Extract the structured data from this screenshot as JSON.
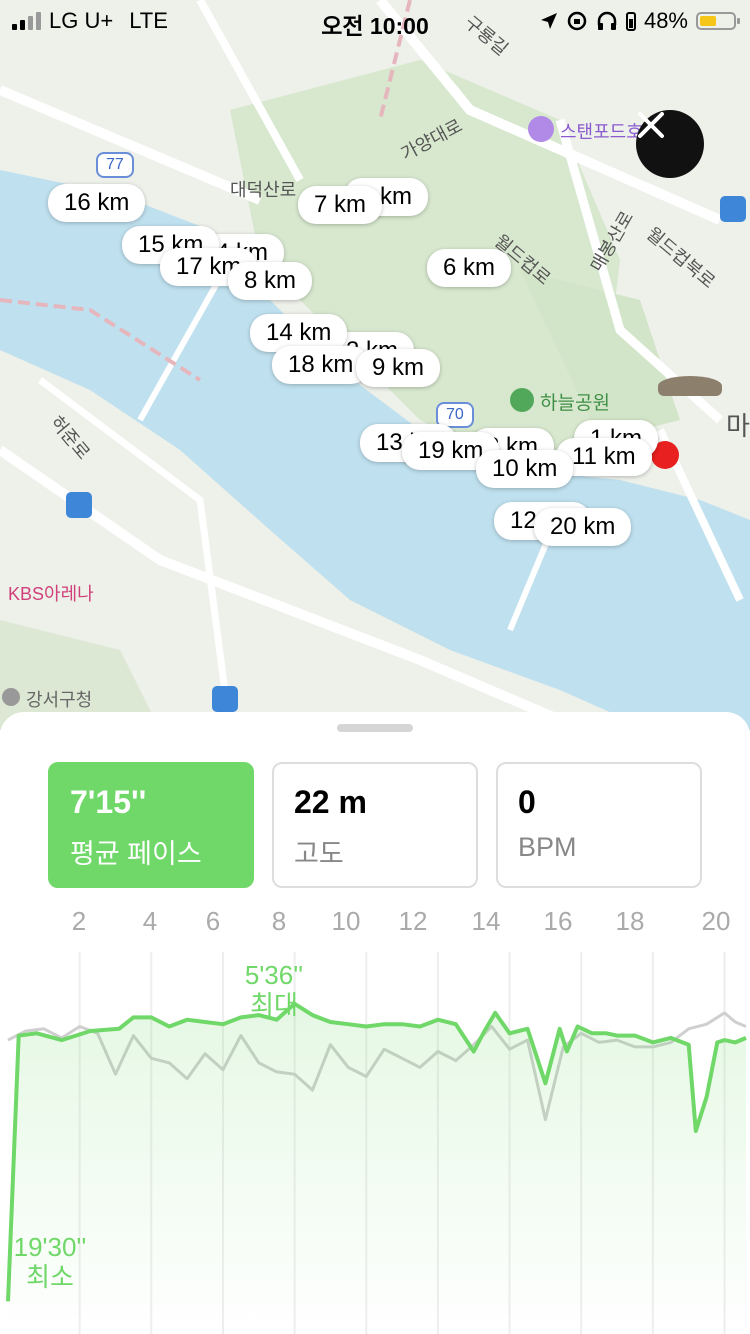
{
  "status_bar": {
    "carrier": "LG U+",
    "network": "LTE",
    "time": "오전 10:00",
    "battery": "48%"
  },
  "map": {
    "labels": {
      "road_77": "77",
      "road_70": "70",
      "guryong": "구룡길",
      "gayang": "가양대로",
      "hotel": "스탠포드호",
      "daedeok": "대덕산로",
      "maebong": "매봉산로",
      "worldcup": "월드컵북로",
      "worldcup2": "월드컵로",
      "haneul": "하늘공원",
      "heojun": "허준로",
      "kbs": "KBS아레나",
      "gangseo": "강서구청",
      "ma": "마"
    },
    "km_markers": [
      "16 km",
      "7 km",
      "5 km",
      "15 km",
      "4 km",
      "17 km",
      "8 km",
      "6 km",
      "14 km",
      "3 km",
      "18 km",
      "9 km",
      "13 km",
      "19 km",
      "2 km",
      "10 km",
      "1 km",
      "11 km",
      "12 km",
      "20 km"
    ]
  },
  "cards": [
    {
      "value": "7'15''",
      "label": "평균 페이스",
      "active": true
    },
    {
      "value": "22 m",
      "label": "고도",
      "active": false
    },
    {
      "value": "0",
      "label": "BPM",
      "active": false
    }
  ],
  "chart_data": {
    "type": "line",
    "x_ticks": [
      "2",
      "4",
      "6",
      "8",
      "10",
      "12",
      "14",
      "16",
      "18",
      "20"
    ],
    "annotations": {
      "max_value": "5'36''",
      "max_label": "최대",
      "min_value": "19'30''",
      "min_label": "최소"
    },
    "series": [
      {
        "color": "#6fd868",
        "x": [
          0,
          0.3,
          0.8,
          1.5,
          2.3,
          3.1,
          3.5,
          4.0,
          4.5,
          5.0,
          5.5,
          6.0,
          6.5,
          7.0,
          7.5,
          8.0,
          8.5,
          9.0,
          9.5,
          10.0,
          10.5,
          11.0,
          11.5,
          12.0,
          12.5,
          13.0,
          13.3,
          13.6,
          14.0,
          14.5,
          15.0,
          15.4,
          15.6,
          15.9,
          16.3,
          16.7,
          17.0,
          17.5,
          18.0,
          18.5,
          19.0,
          19.2,
          19.5,
          19.8,
          20.0,
          20.3,
          20.6
        ],
        "y": [
          19.5,
          7.8,
          7.7,
          8.0,
          7.6,
          7.5,
          7.0,
          7.0,
          7.4,
          7.1,
          7.2,
          7.3,
          7.0,
          6.9,
          7.1,
          6.4,
          6.9,
          7.2,
          7.3,
          7.4,
          7.3,
          7.3,
          7.4,
          7.1,
          7.3,
          8.5,
          7.6,
          6.8,
          7.7,
          7.5,
          9.9,
          7.5,
          8.5,
          7.4,
          7.7,
          7.7,
          7.8,
          7.8,
          8.1,
          7.9,
          8.2,
          12.0,
          10.5,
          8.1,
          8.0,
          8.1,
          7.9
        ]
      },
      {
        "color": "#cfcfcf",
        "x": [
          0,
          0.5,
          1.0,
          1.5,
          2.0,
          2.5,
          3.0,
          3.5,
          4.0,
          4.5,
          5.0,
          5.5,
          6.0,
          6.5,
          7.0,
          7.5,
          8.0,
          8.5,
          9.0,
          9.5,
          10.0,
          10.5,
          11.0,
          11.5,
          12.0,
          12.5,
          13.0,
          13.5,
          14.0,
          14.5,
          15.0,
          15.5,
          16.0,
          16.5,
          17.0,
          17.5,
          18.0,
          18.5,
          19.0,
          19.5,
          20.0,
          20.3,
          20.6
        ],
        "y": [
          8.0,
          7.6,
          7.5,
          7.9,
          7.4,
          7.7,
          9.5,
          7.8,
          8.8,
          9.0,
          9.7,
          8.6,
          9.3,
          7.8,
          9.0,
          9.4,
          9.5,
          10.2,
          8.2,
          9.2,
          9.6,
          8.4,
          8.8,
          9.2,
          8.5,
          8.9,
          8.2,
          7.4,
          8.4,
          8.0,
          11.5,
          8.3,
          7.7,
          8.1,
          8.0,
          8.3,
          8.3,
          8.1,
          7.5,
          7.3,
          6.8,
          7.2,
          7.4
        ]
      }
    ],
    "x_range": [
      0,
      20.6
    ],
    "y_inverted": true,
    "y_range": [
      5.0,
      20.5
    ]
  }
}
